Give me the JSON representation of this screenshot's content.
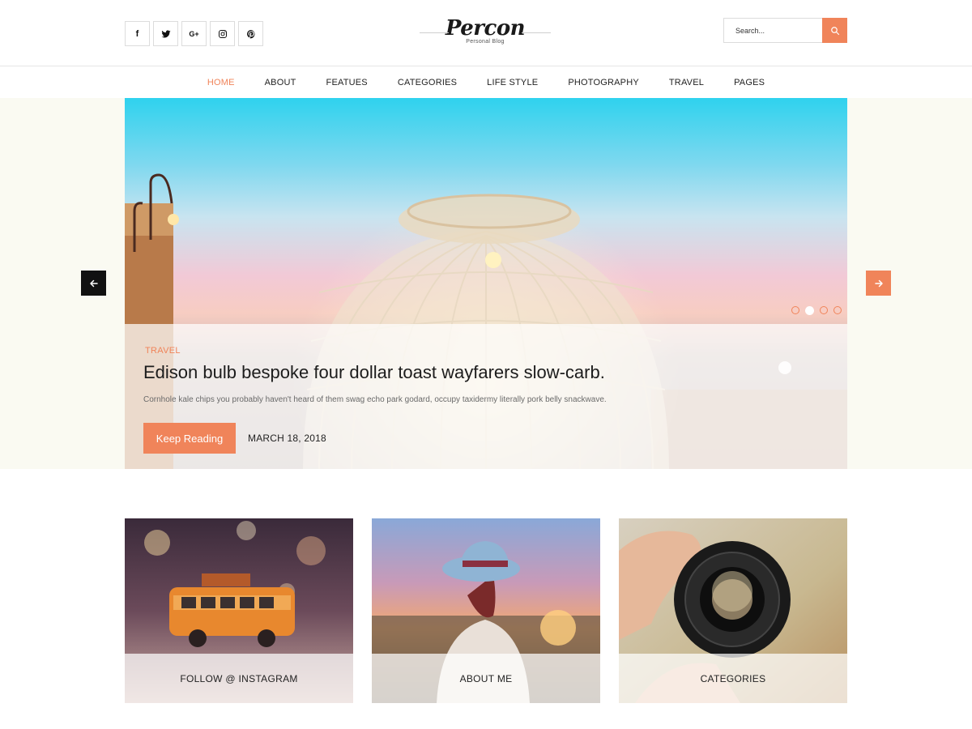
{
  "header": {
    "socials": [
      {
        "icon": "facebook-icon",
        "glyph": "f"
      },
      {
        "icon": "twitter-icon",
        "glyph": ""
      },
      {
        "icon": "google-plus-icon",
        "glyph": "G+"
      },
      {
        "icon": "instagram-icon",
        "glyph": ""
      },
      {
        "icon": "pinterest-icon",
        "glyph": ""
      }
    ],
    "logo": {
      "name": "Percon",
      "tagline": "Personal Blog"
    },
    "search": {
      "placeholder": "Search...",
      "icon": "search-icon"
    }
  },
  "nav": {
    "items": [
      {
        "label": "HOME",
        "active": true
      },
      {
        "label": "ABOUT"
      },
      {
        "label": "FEATUES"
      },
      {
        "label": "CATEGORIES"
      },
      {
        "label": "LIFE STYLE"
      },
      {
        "label": "PHOTOGRAPHY"
      },
      {
        "label": "TRAVEL"
      },
      {
        "label": "PAGES"
      }
    ]
  },
  "hero": {
    "category": "TRAVEL",
    "title": "Edison bulb bespoke four dollar toast wayfarers slow-carb.",
    "excerpt": "Cornhole kale chips you probably haven't heard of them swag echo park godard, occupy taxidermy literally pork belly snackwave.",
    "button_label": "Keep Reading",
    "date": "MARCH 18, 2018",
    "slides": 4,
    "active_slide": 2
  },
  "cards": [
    {
      "label": "FOLLOW @ INSTAGRAM",
      "image": "toy-van-photo"
    },
    {
      "label": "ABOUT ME",
      "image": "woman-sunset-photo"
    },
    {
      "label": "CATEGORIES",
      "image": "camera-lens-photo"
    }
  ],
  "colors": {
    "accent": "#f0845a",
    "dark": "#111111",
    "band": "#fafaf2"
  }
}
